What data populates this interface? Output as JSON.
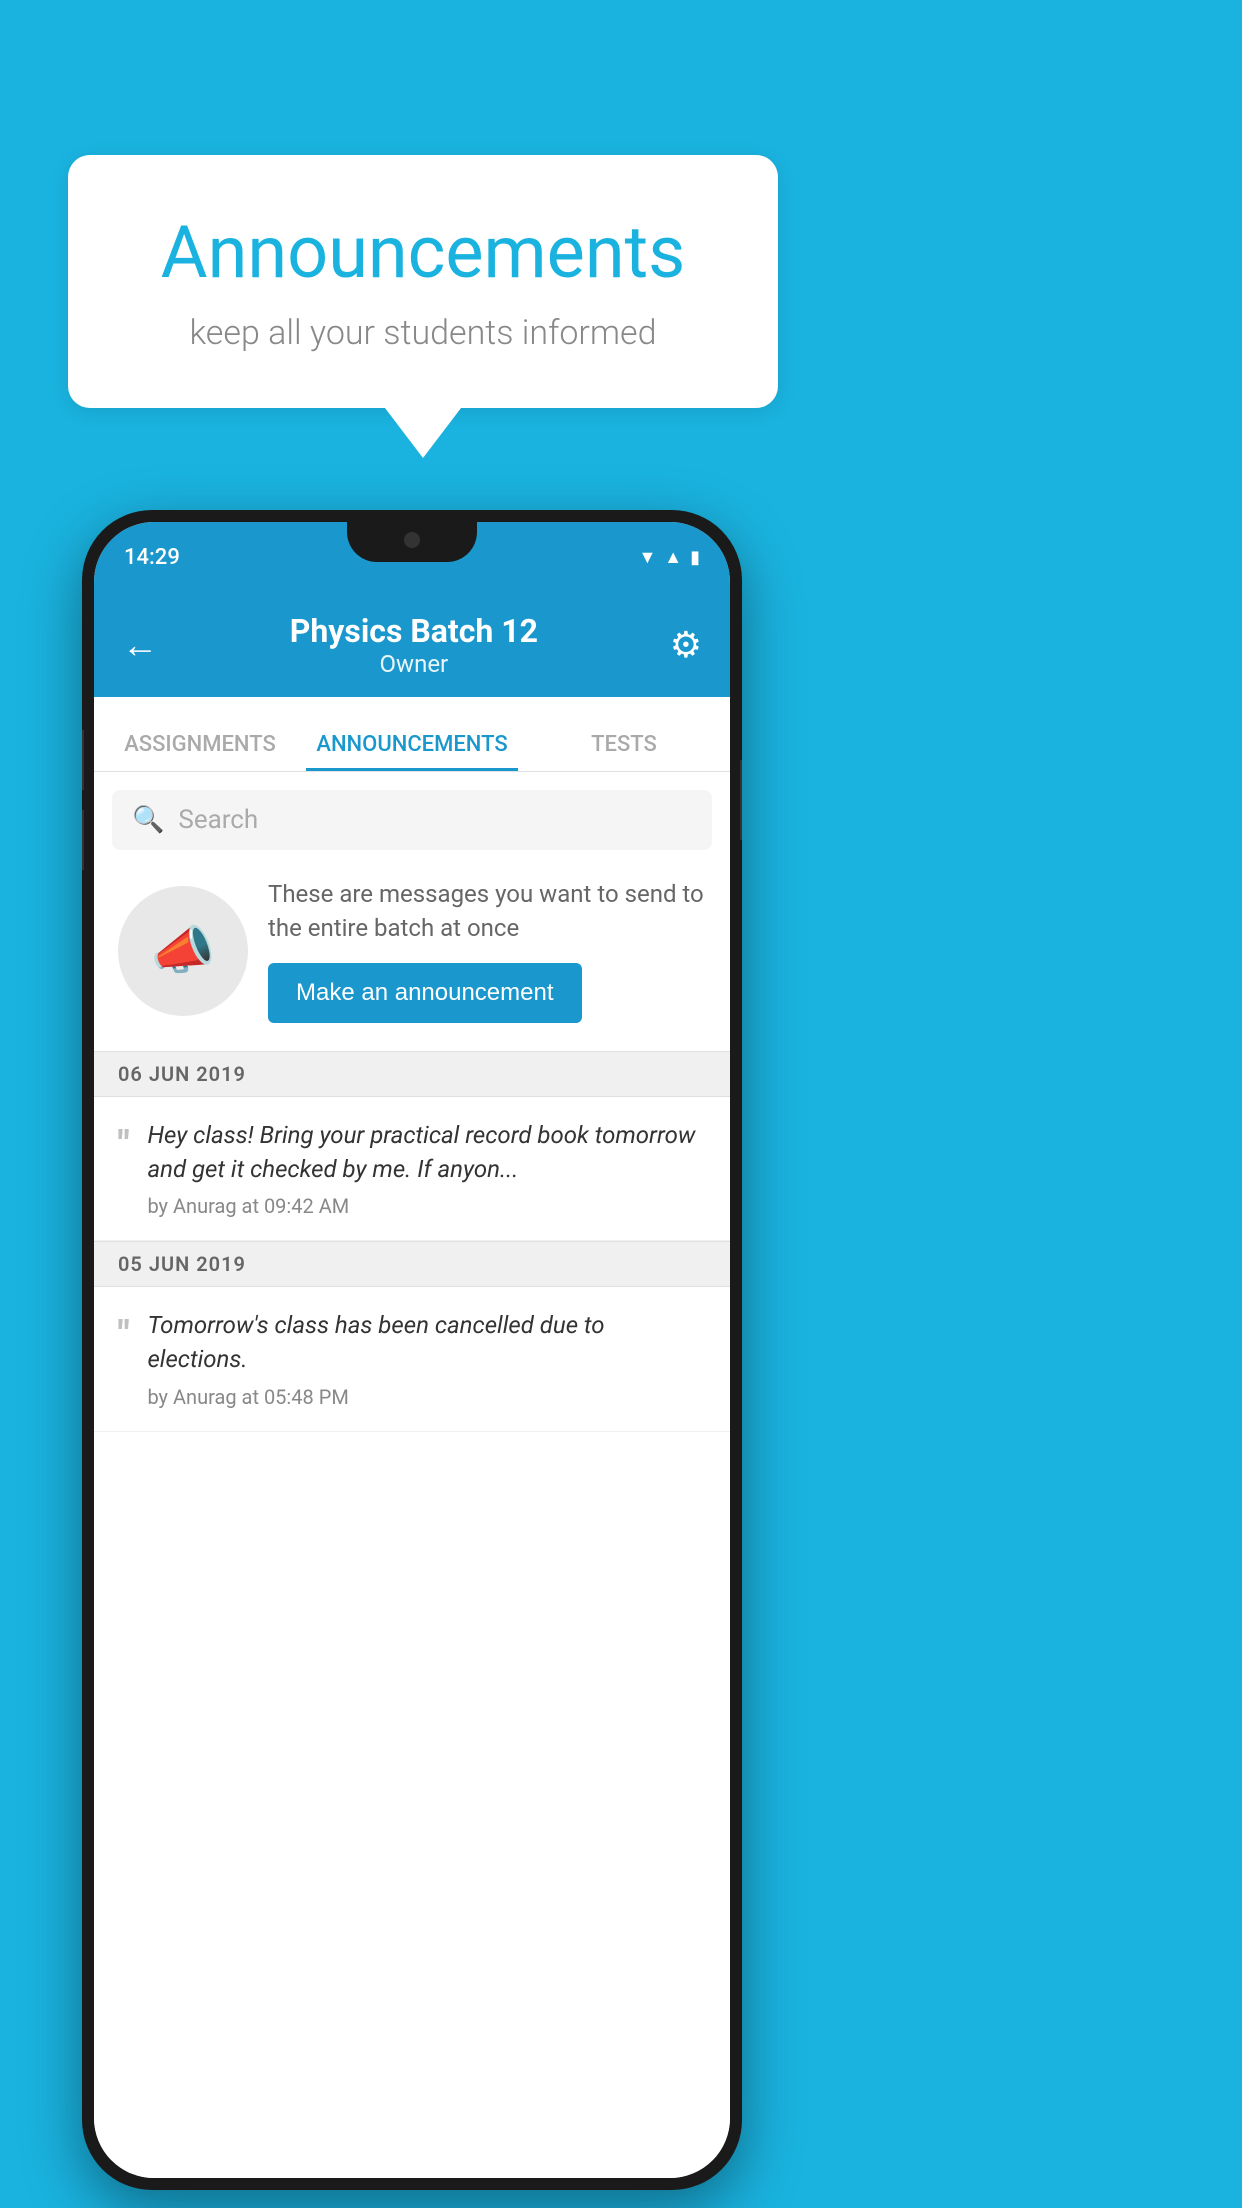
{
  "background_color": "#1ab3e0",
  "speech_bubble": {
    "title": "Announcements",
    "subtitle": "keep all your students informed"
  },
  "phone": {
    "status_bar": {
      "time": "14:29",
      "wifi_icon": "wifi",
      "signal_icon": "signal",
      "battery_icon": "battery"
    },
    "app_header": {
      "back_icon": "←",
      "title": "Physics Batch 12",
      "subtitle": "Owner",
      "settings_icon": "⚙"
    },
    "tabs": [
      {
        "label": "ASSIGNMENTS",
        "active": false
      },
      {
        "label": "ANNOUNCEMENTS",
        "active": true
      },
      {
        "label": "TESTS",
        "active": false
      },
      {
        "label": "...",
        "active": false
      }
    ],
    "search": {
      "placeholder": "Search"
    },
    "announcement_intro": {
      "icon": "📣",
      "description_text": "These are messages you want to send to the entire batch at once",
      "button_label": "Make an announcement"
    },
    "date_groups": [
      {
        "date_label": "06  JUN  2019",
        "items": [
          {
            "message": "Hey class! Bring your practical record book tomorrow and get it checked by me. If anyon...",
            "meta": "by Anurag at 09:42 AM"
          }
        ]
      },
      {
        "date_label": "05  JUN  2019",
        "items": [
          {
            "message": "Tomorrow's class has been cancelled due to elections.",
            "meta": "by Anurag at 05:48 PM"
          }
        ]
      }
    ]
  }
}
